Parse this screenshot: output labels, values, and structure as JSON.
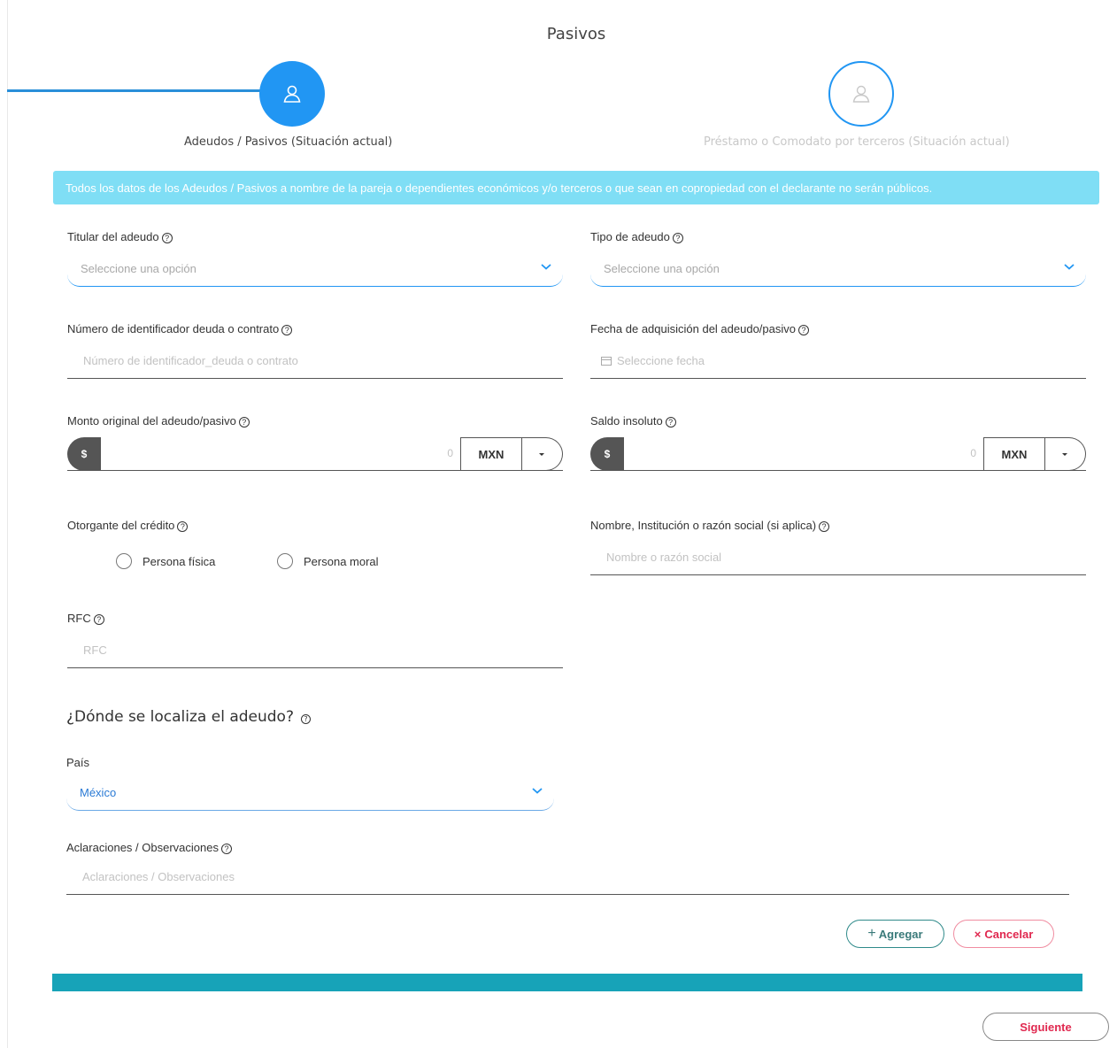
{
  "page": {
    "title": "Pasivos"
  },
  "steps": [
    {
      "label": "Adeudos / Pasivos (Situación actual)",
      "active": true
    },
    {
      "label": "Préstamo o Comodato por terceros (Situación actual)",
      "active": false
    }
  ],
  "banner": {
    "text": "Todos los datos de los Adeudos / Pasivos a nombre de la pareja o dependientes económicos y/o terceros o que sean en copropiedad con el declarante no serán públicos."
  },
  "fields": {
    "titular": {
      "label": "Titular del adeudo",
      "placeholder": "Seleccione una opción"
    },
    "tipo": {
      "label": "Tipo de adeudo",
      "placeholder": "Seleccione una opción"
    },
    "numero": {
      "label": "Número de identificador deuda o contrato",
      "placeholder": "Número de identificador_deuda o contrato"
    },
    "fecha": {
      "label": "Fecha de adquisición del adeudo/pasivo",
      "placeholder": "Seleccione fecha"
    },
    "monto": {
      "label": "Monto original del adeudo/pasivo",
      "symbol": "$",
      "value": "0",
      "currency": "MXN"
    },
    "saldo": {
      "label": "Saldo insoluto",
      "symbol": "$",
      "value": "0",
      "currency": "MXN"
    },
    "otorgante": {
      "label": "Otorgante del crédito",
      "options": [
        "Persona física",
        "Persona moral"
      ]
    },
    "nombre": {
      "label": "Nombre, Institución o razón social (si aplica)",
      "placeholder": "Nombre o razón social"
    },
    "rfc": {
      "label": "RFC",
      "placeholder": "RFC"
    },
    "pais": {
      "label": "País",
      "value": "México"
    },
    "aclaraciones": {
      "label": "Aclaraciones / Observaciones",
      "placeholder": "Aclaraciones / Observaciones"
    }
  },
  "location_section": {
    "title": "¿Dónde se localiza el adeudo?"
  },
  "buttons": {
    "add": "Agregar",
    "cancel": "Cancelar",
    "next": "Siguiente"
  },
  "help_glyph": "?",
  "colors": {
    "primary": "#2196f3",
    "banner": "#7fdef5",
    "bar": "#17a3b8",
    "danger": "#e0284f"
  }
}
